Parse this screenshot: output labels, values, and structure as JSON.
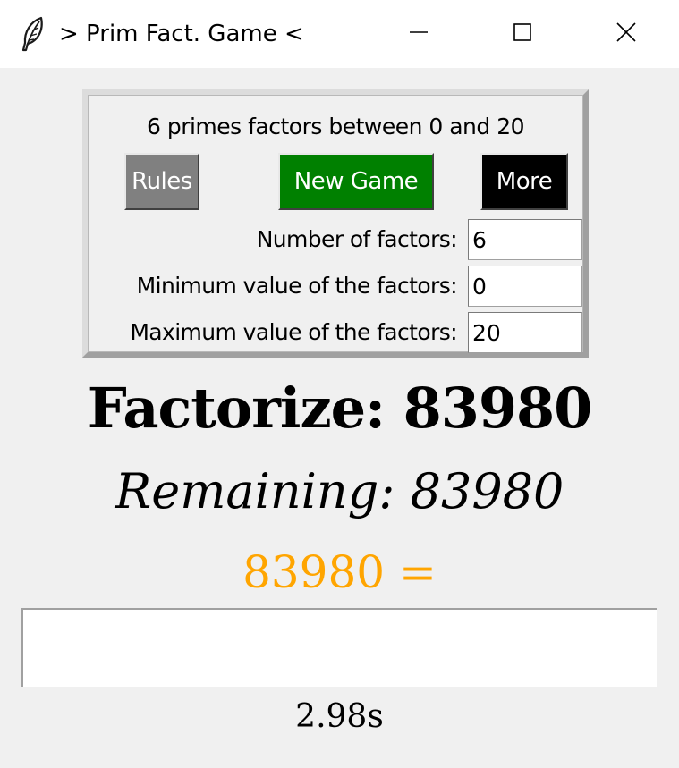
{
  "window": {
    "title": "> Prim Fact. Game <",
    "icon": "feather-icon",
    "controls": [
      "minimize-icon",
      "maximize-icon",
      "close-icon"
    ]
  },
  "settings": {
    "caption": "6 primes factors between 0 and 20",
    "buttons": {
      "rules": "Rules",
      "new_game": "New Game",
      "more": "More"
    },
    "button_colors": {
      "rules": "#808080",
      "new_game": "#008000",
      "more": "#000000"
    },
    "fields": [
      {
        "label": "Number of factors:",
        "value": "6"
      },
      {
        "label": "Minimum value of the factors:",
        "value": "0"
      },
      {
        "label": "Maximum value of the factors:",
        "value": "20"
      }
    ]
  },
  "game": {
    "factorize": "Factorize: 83980",
    "remaining": "Remaining: 83980",
    "equation": "83980 =",
    "equation_color": "#ffa500",
    "answer_value": "",
    "timer": "2.98s"
  }
}
